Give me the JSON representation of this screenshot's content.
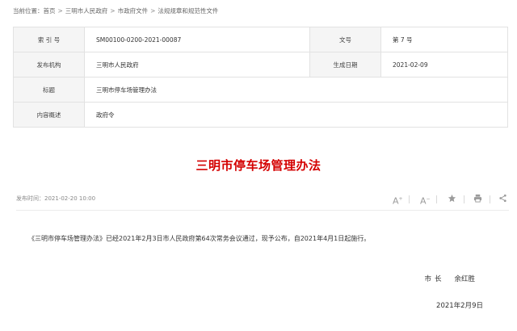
{
  "breadcrumb": {
    "prefix": "当前位置：",
    "items": [
      "首页",
      "三明市人民政府",
      "市政府文件",
      "法规规章和规范性文件"
    ],
    "separator": ">"
  },
  "meta": {
    "index_label": "索 引 号",
    "index_value": "SM00100-0200-2021-00087",
    "doc_no_label": "文号",
    "doc_no_value": "第 7 号",
    "publisher_label": "发布机构",
    "publisher_value": "三明市人民政府",
    "created_label": "生成日期",
    "created_value": "2021-02-09",
    "title_label": "标题",
    "title_value": "三明市停车场管理办法",
    "summary_label": "内容概述",
    "summary_value": "政府令"
  },
  "article": {
    "title": "三明市停车场管理办法",
    "publish_time": "发布时间：2021-02-20 10:00",
    "body": "《三明市停车场管理办法》已经2021年2月3日市人民政府第64次常务会议通过，现予公布，自2021年4月1日起施行。",
    "signer_role": "市长",
    "signer_name": "余红胜",
    "sign_date": "2021年2月9日"
  },
  "toolbar": {
    "font_increase_icon": "A+",
    "font_decrease_icon": "A−",
    "favorite_icon": "★",
    "print_icon": "⎙",
    "share_icon": "share"
  }
}
